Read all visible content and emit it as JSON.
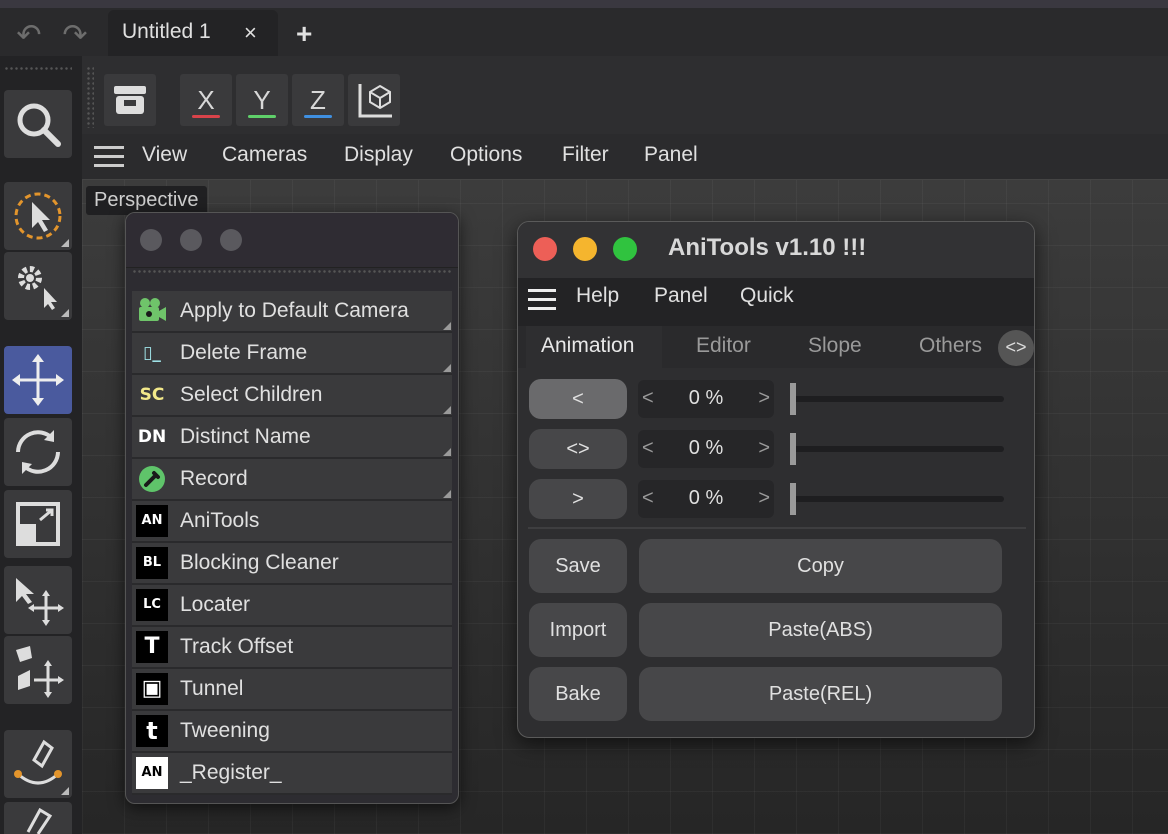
{
  "app": {
    "tab_title": "Untitled 1",
    "tab_close": "×",
    "tab_add": "+",
    "undo_icon": "undo-icon",
    "redo_icon": "redo-icon"
  },
  "viewport": {
    "axis_buttons": [
      {
        "label": "X",
        "color": "#d9434a"
      },
      {
        "label": "Y",
        "color": "#5fd06a"
      },
      {
        "label": "Z",
        "color": "#3f8fe0"
      }
    ],
    "menu": [
      "View",
      "Cameras",
      "Display",
      "Options",
      "Filter",
      "Panel"
    ],
    "camera_label": "Perspective"
  },
  "left_toolbar": [
    {
      "icon": "search-icon"
    },
    {
      "icon": "select-icon"
    },
    {
      "icon": "tool-settings-icon"
    },
    {
      "icon": "move-icon",
      "active": true
    },
    {
      "icon": "rotate-icon"
    },
    {
      "icon": "scale-icon"
    },
    {
      "icon": "transfer-icon"
    },
    {
      "icon": "multi-transform-icon"
    },
    {
      "icon": "spline-pen-icon"
    },
    {
      "icon": "sketch-pen-icon"
    }
  ],
  "script_manager": {
    "items": [
      {
        "label": "Apply to Default Camera",
        "icon_text": "",
        "icon": "camera-icon"
      },
      {
        "label": "Delete Frame",
        "icon_text": "▯_",
        "icon": "delete-frame-icon"
      },
      {
        "label": "Select Children",
        "icon_text": "SC",
        "icon": "select-children-icon"
      },
      {
        "label": "Distinct Name",
        "icon_text": "DN",
        "icon": "distinct-name-icon"
      },
      {
        "label": "Record",
        "icon_text": "",
        "icon": "record-icon"
      },
      {
        "label": "AniTools",
        "icon_text": "AN",
        "icon": "anitools-icon"
      },
      {
        "label": "Blocking Cleaner",
        "icon_text": "BL",
        "icon": "blocking-cleaner-icon"
      },
      {
        "label": "Locater",
        "icon_text": "LC",
        "icon": "locater-icon"
      },
      {
        "label": "Track Offset",
        "icon_text": "T",
        "icon": "track-offset-icon"
      },
      {
        "label": "Tunnel",
        "icon_text": "▣",
        "icon": "tunnel-icon"
      },
      {
        "label": "Tweening",
        "icon_text": "t",
        "icon": "tweening-icon"
      },
      {
        "label": "_Register_",
        "icon_text": "AN",
        "icon": "register-icon"
      }
    ]
  },
  "anitools": {
    "title": "AniTools v1.10 !!!",
    "menu": [
      "Help",
      "Panel",
      "Quick"
    ],
    "tabs": [
      "Animation",
      "Editor",
      "Slope",
      "Others"
    ],
    "tab_scroll": "<>",
    "rows": [
      {
        "button": "<",
        "value": "0 %",
        "slider_fraction": 0
      },
      {
        "button": "<>",
        "value": "0 %",
        "slider_fraction": 0
      },
      {
        "button": ">",
        "value": "0 %",
        "slider_fraction": 0
      }
    ],
    "stepper_left": "<",
    "stepper_right": ">",
    "actions": [
      {
        "left": "Save",
        "right": "Copy"
      },
      {
        "left": "Import",
        "right": "Paste(ABS)"
      },
      {
        "left": "Bake",
        "right": "Paste(REL)"
      }
    ],
    "traffic_lights": [
      "#ed5f57",
      "#f5b52e",
      "#30c33f"
    ]
  }
}
